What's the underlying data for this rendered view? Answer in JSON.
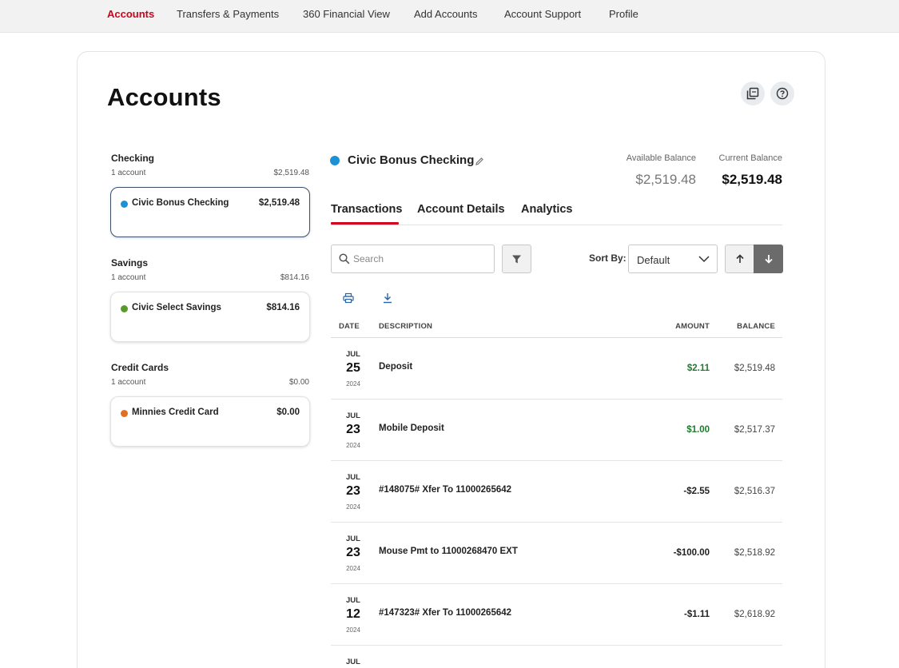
{
  "nav": {
    "items": [
      {
        "label": "Accounts",
        "active": true
      },
      {
        "label": "Transfers & Payments",
        "active": false
      },
      {
        "label": "360 Financial View",
        "active": false
      },
      {
        "label": "Add Accounts",
        "active": false
      },
      {
        "label": "Account Support",
        "active": false
      },
      {
        "label": "Profile",
        "active": false
      }
    ],
    "active_color": "#d0021b"
  },
  "page": {
    "title": "Accounts",
    "icons": [
      "multi-window-icon",
      "help-icon"
    ]
  },
  "sidebar": {
    "groups": [
      {
        "title": "Checking",
        "count": "1 account",
        "total": "$2,519.48",
        "accounts": [
          {
            "name": "Civic Bonus Checking",
            "balance": "$2,519.48",
            "dot_color": "#1e90d6",
            "selected": true
          }
        ]
      },
      {
        "title": "Savings",
        "count": "1 account",
        "total": "$814.16",
        "accounts": [
          {
            "name": "Civic Select Savings",
            "balance": "$814.16",
            "dot_color": "#5a9a2a",
            "selected": false
          }
        ]
      },
      {
        "title": "Credit Cards",
        "count": "1 account",
        "total": "$0.00",
        "accounts": [
          {
            "name": "Minnies Credit Card",
            "balance": "$0.00",
            "dot_color": "#e07020",
            "selected": false
          }
        ]
      }
    ]
  },
  "account": {
    "name": "Civic Bonus Checking",
    "dot_color": "#1e90d6",
    "available_label": "Available Balance",
    "available_value": "$2,519.48",
    "current_label": "Current Balance",
    "current_value": "$2,519.48"
  },
  "tabs": [
    {
      "label": "Transactions",
      "active": true
    },
    {
      "label": "Account Details",
      "active": false
    },
    {
      "label": "Analytics",
      "active": false
    }
  ],
  "toolbar": {
    "search_placeholder": "Search",
    "sort_label": "Sort By:",
    "sort_value": "Default"
  },
  "table": {
    "headers": {
      "date": "DATE",
      "description": "DESCRIPTION",
      "amount": "AMOUNT",
      "balance": "BALANCE"
    },
    "rows": [
      {
        "month": "JUL",
        "day": "25",
        "year": "2024",
        "description": "Deposit",
        "amount": "$2.11",
        "positive": true,
        "balance": "$2,519.48"
      },
      {
        "month": "JUL",
        "day": "23",
        "year": "2024",
        "description": "Mobile Deposit",
        "amount": "$1.00",
        "positive": true,
        "balance": "$2,517.37"
      },
      {
        "month": "JUL",
        "day": "23",
        "year": "2024",
        "description": "#148075# Xfer To 11000265642",
        "amount": "-$2.55",
        "positive": false,
        "balance": "$2,516.37"
      },
      {
        "month": "JUL",
        "day": "23",
        "year": "2024",
        "description": "Mouse Pmt to 11000268470 EXT",
        "amount": "-$100.00",
        "positive": false,
        "balance": "$2,518.92"
      },
      {
        "month": "JUL",
        "day": "12",
        "year": "2024",
        "description": "#147323# Xfer To 11000265642",
        "amount": "-$1.11",
        "positive": false,
        "balance": "$2,618.92"
      }
    ],
    "partial_row": {
      "month": "JUL"
    }
  }
}
